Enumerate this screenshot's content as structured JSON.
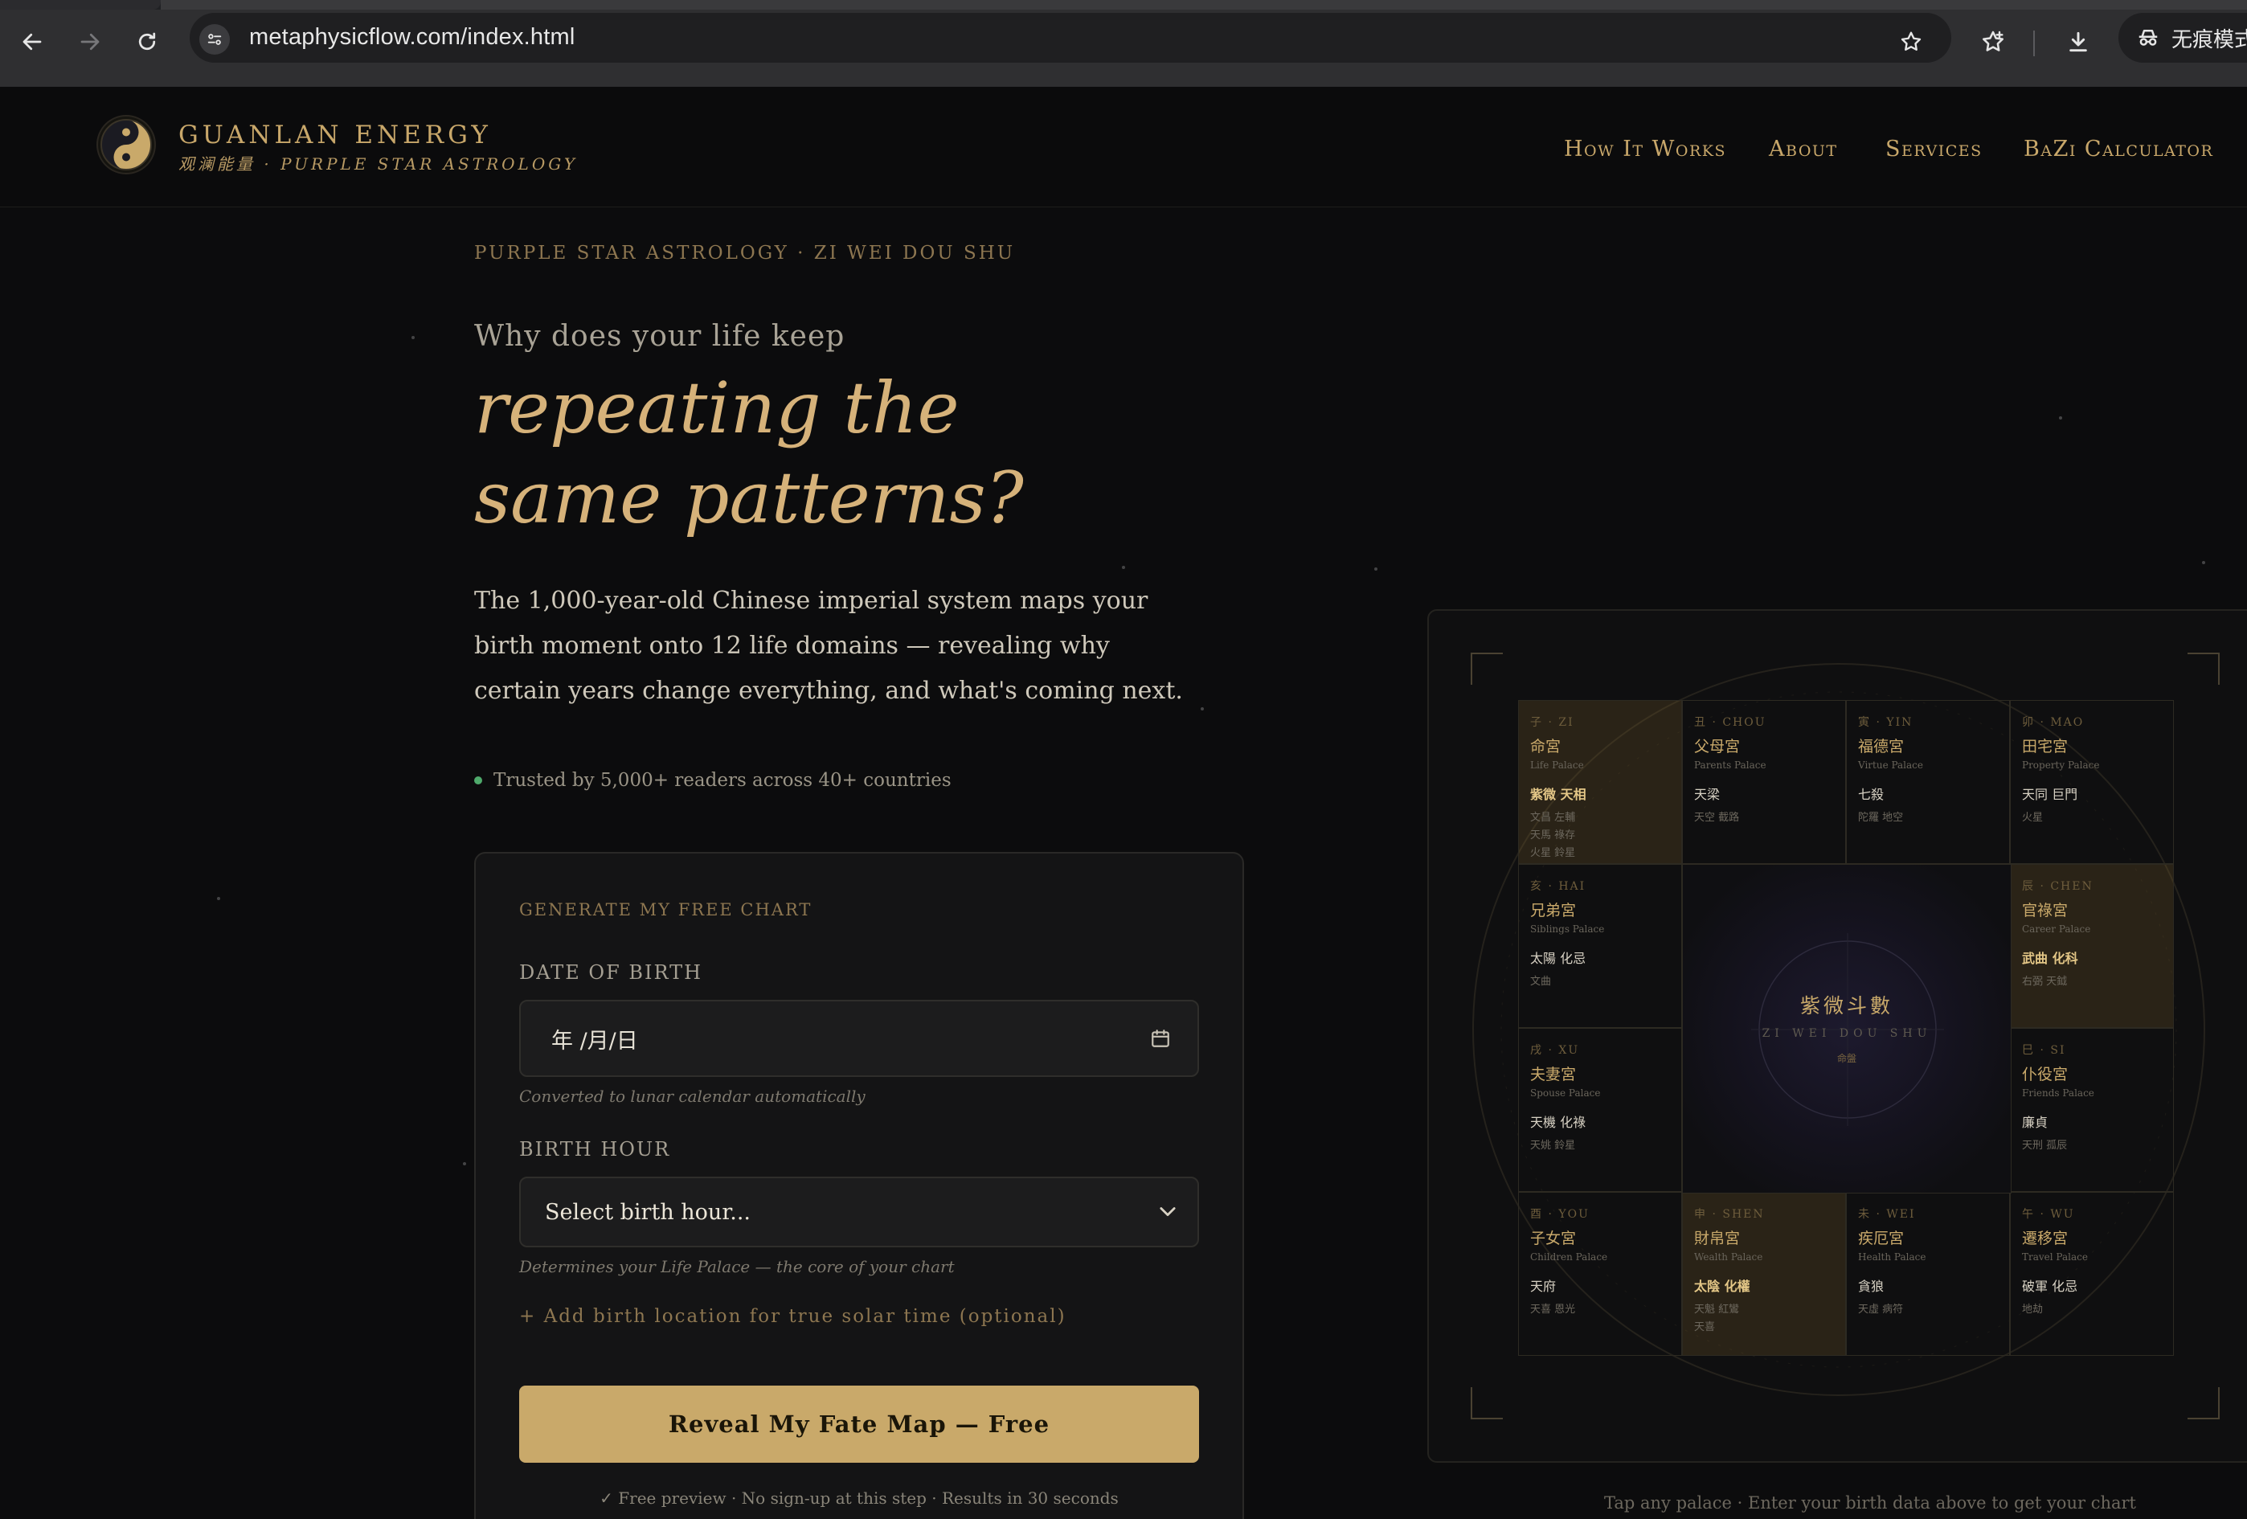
{
  "browser": {
    "url": "metaphysicflow.com/index.html",
    "incognito_label": "无痕模式"
  },
  "header": {
    "brand_name": "GUANLAN ENERGY",
    "brand_sub": "观澜能量 · PURPLE STAR ASTROLOGY",
    "nav": [
      "How It Works",
      "About",
      "Services",
      "BaZi Calculator"
    ]
  },
  "hero": {
    "eyebrow": "PURPLE STAR ASTROLOGY · ZI WEI DOU SHU",
    "lead": "Why does your life keep",
    "title_line1": "repeating the",
    "title_line2": "same patterns?",
    "description": "The 1,000-year-old Chinese imperial system maps your birth moment onto 12 life domains — revealing why certain years change everything, and what's coming next.",
    "trusted": "Trusted by 5,000+ readers across 40+ countries"
  },
  "form": {
    "title": "GENERATE MY FREE CHART",
    "dob_label": "DATE OF BIRTH",
    "dob_value": "年 /月/日",
    "dob_hint": "Converted to lunar calendar automatically",
    "hour_label": "BIRTH HOUR",
    "hour_value": "Select birth hour...",
    "hour_hint": "Determines your Life Palace — the core of your chart",
    "add_location": "+ Add birth location for true solar time (optional)",
    "cta": "Reveal My Fate Map — Free",
    "cta_note": "✓ Free preview · No sign-up at this step · Results in 30 seconds"
  },
  "chart": {
    "center_title": "紫微斗數",
    "center_sub": "ZI WEI DOU SHU",
    "center_mini": "命盤",
    "hint": "Tap any palace · Enter your birth data above to get your chart",
    "palaces": [
      {
        "branch": "子 · ZI",
        "name": "命宮",
        "en": "Life Palace",
        "main": "紫微 天相",
        "minor": [
          "文昌 左輔",
          "天馬 祿存",
          "火星 鈴星"
        ],
        "highlight": true
      },
      {
        "branch": "丑 · CHOU",
        "name": "父母宮",
        "en": "Parents Palace",
        "main": "天梁",
        "minor": [
          "天空 截路"
        ],
        "highlight": false
      },
      {
        "branch": "寅 · YIN",
        "name": "福德宮",
        "en": "Virtue Palace",
        "main": "七殺",
        "minor": [
          "陀羅 地空"
        ],
        "highlight": false
      },
      {
        "branch": "卯 · MAO",
        "name": "田宅宮",
        "en": "Property Palace",
        "main": "天同 巨門",
        "minor": [
          "火星"
        ],
        "highlight": false
      },
      {
        "branch": "亥 · HAI",
        "name": "兄弟宮",
        "en": "Siblings Palace",
        "main": "太陽 化忌",
        "minor": [
          "文曲"
        ],
        "highlight": false
      },
      {
        "branch": "辰 · CHEN",
        "name": "官祿宮",
        "en": "Career Palace",
        "main": "武曲 化科",
        "minor": [
          "右弼 天鉞"
        ],
        "highlight": true
      },
      {
        "branch": "戌 · XU",
        "name": "夫妻宮",
        "en": "Spouse Palace",
        "main": "天機 化祿",
        "minor": [
          "天姚 鈴星"
        ],
        "highlight": false
      },
      {
        "branch": "巳 · SI",
        "name": "仆役宮",
        "en": "Friends Palace",
        "main": "廉貞",
        "minor": [
          "天刑 孤辰"
        ],
        "highlight": false
      },
      {
        "branch": "酉 · YOU",
        "name": "子女宮",
        "en": "Children Palace",
        "main": "天府",
        "minor": [
          "天喜 恩光"
        ],
        "highlight": false
      },
      {
        "branch": "申 · SHEN",
        "name": "財帛宮",
        "en": "Wealth Palace",
        "main": "太陰 化權",
        "minor": [
          "天魁 紅鸞",
          "天喜"
        ],
        "highlight": true
      },
      {
        "branch": "未 · WEI",
        "name": "疾厄宮",
        "en": "Health Palace",
        "main": "貪狼",
        "minor": [
          "天虛 病符"
        ],
        "highlight": false
      },
      {
        "branch": "午 · WU",
        "name": "遷移宮",
        "en": "Travel Palace",
        "main": "破軍 化忌",
        "minor": [
          "地劫"
        ],
        "highlight": false
      }
    ]
  }
}
